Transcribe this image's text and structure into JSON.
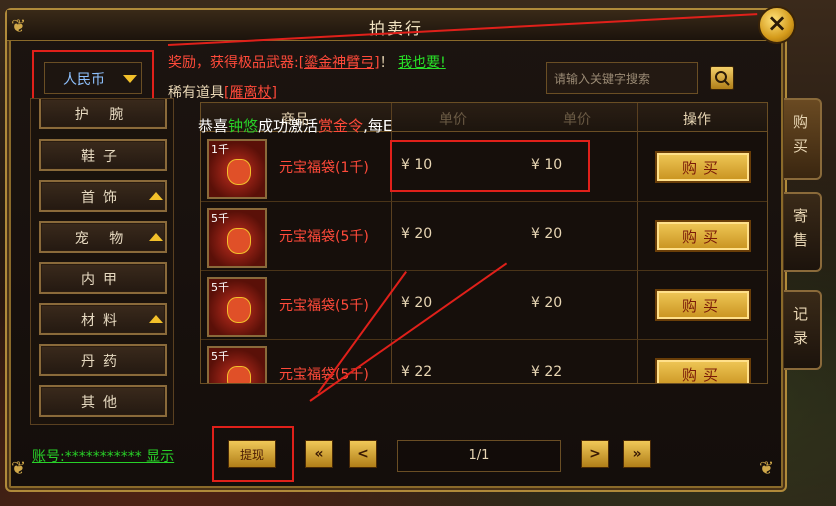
{
  "window": {
    "title": "拍卖行",
    "close_icon": "close-icon"
  },
  "currency": {
    "selected": "人民币"
  },
  "announcement": {
    "prefix": "奖励，获得极品武器:",
    "item": "[鎏金神臂弓]",
    "suffix": "！",
    "cta": "我也要!",
    "line2_prefix": "稀有道具",
    "line2_item": "[雁离杖]"
  },
  "search": {
    "placeholder": "请输入关键字搜索"
  },
  "sidebar": {
    "items": [
      {
        "label": "护 腕",
        "expand": false
      },
      {
        "label": "鞋子",
        "expand": false
      },
      {
        "label": "首饰",
        "expand": true
      },
      {
        "label": "宠 物",
        "expand": true
      },
      {
        "label": "内甲",
        "expand": false
      },
      {
        "label": "材料",
        "expand": true
      },
      {
        "label": "丹药",
        "expand": false
      },
      {
        "label": "其他",
        "expand": false
      }
    ]
  },
  "table": {
    "headers": {
      "product": "商品",
      "price": "单价",
      "unit_price": "单价",
      "action": "操作"
    },
    "notice": {
      "a": "恭喜",
      "b": "钟悠",
      "c": "成功激活",
      "d": "赏金令",
      "e": ",每E"
    },
    "rows": [
      {
        "qty": "1千",
        "name": "元宝福袋(1千)",
        "price": "¥ 10",
        "unit": "¥ 10",
        "buy": "购买"
      },
      {
        "qty": "5千",
        "name": "元宝福袋(5千)",
        "price": "¥ 20",
        "unit": "¥ 20",
        "buy": "购买"
      },
      {
        "qty": "5千",
        "name": "元宝福袋(5千)",
        "price": "¥ 20",
        "unit": "¥ 20",
        "buy": "购买"
      },
      {
        "qty": "5千",
        "name": "元宝福袋(5千)",
        "price": "¥ 22",
        "unit": "¥ 22",
        "buy": "购买"
      }
    ]
  },
  "right_tabs": [
    "购买",
    "寄售",
    "记录"
  ],
  "footer": {
    "account": "账号:***********  显示",
    "withdraw": "提现",
    "first": "«",
    "prev": "<",
    "page": "1/1",
    "next": ">",
    "last": "»"
  },
  "annotation_color": "#e0201a"
}
